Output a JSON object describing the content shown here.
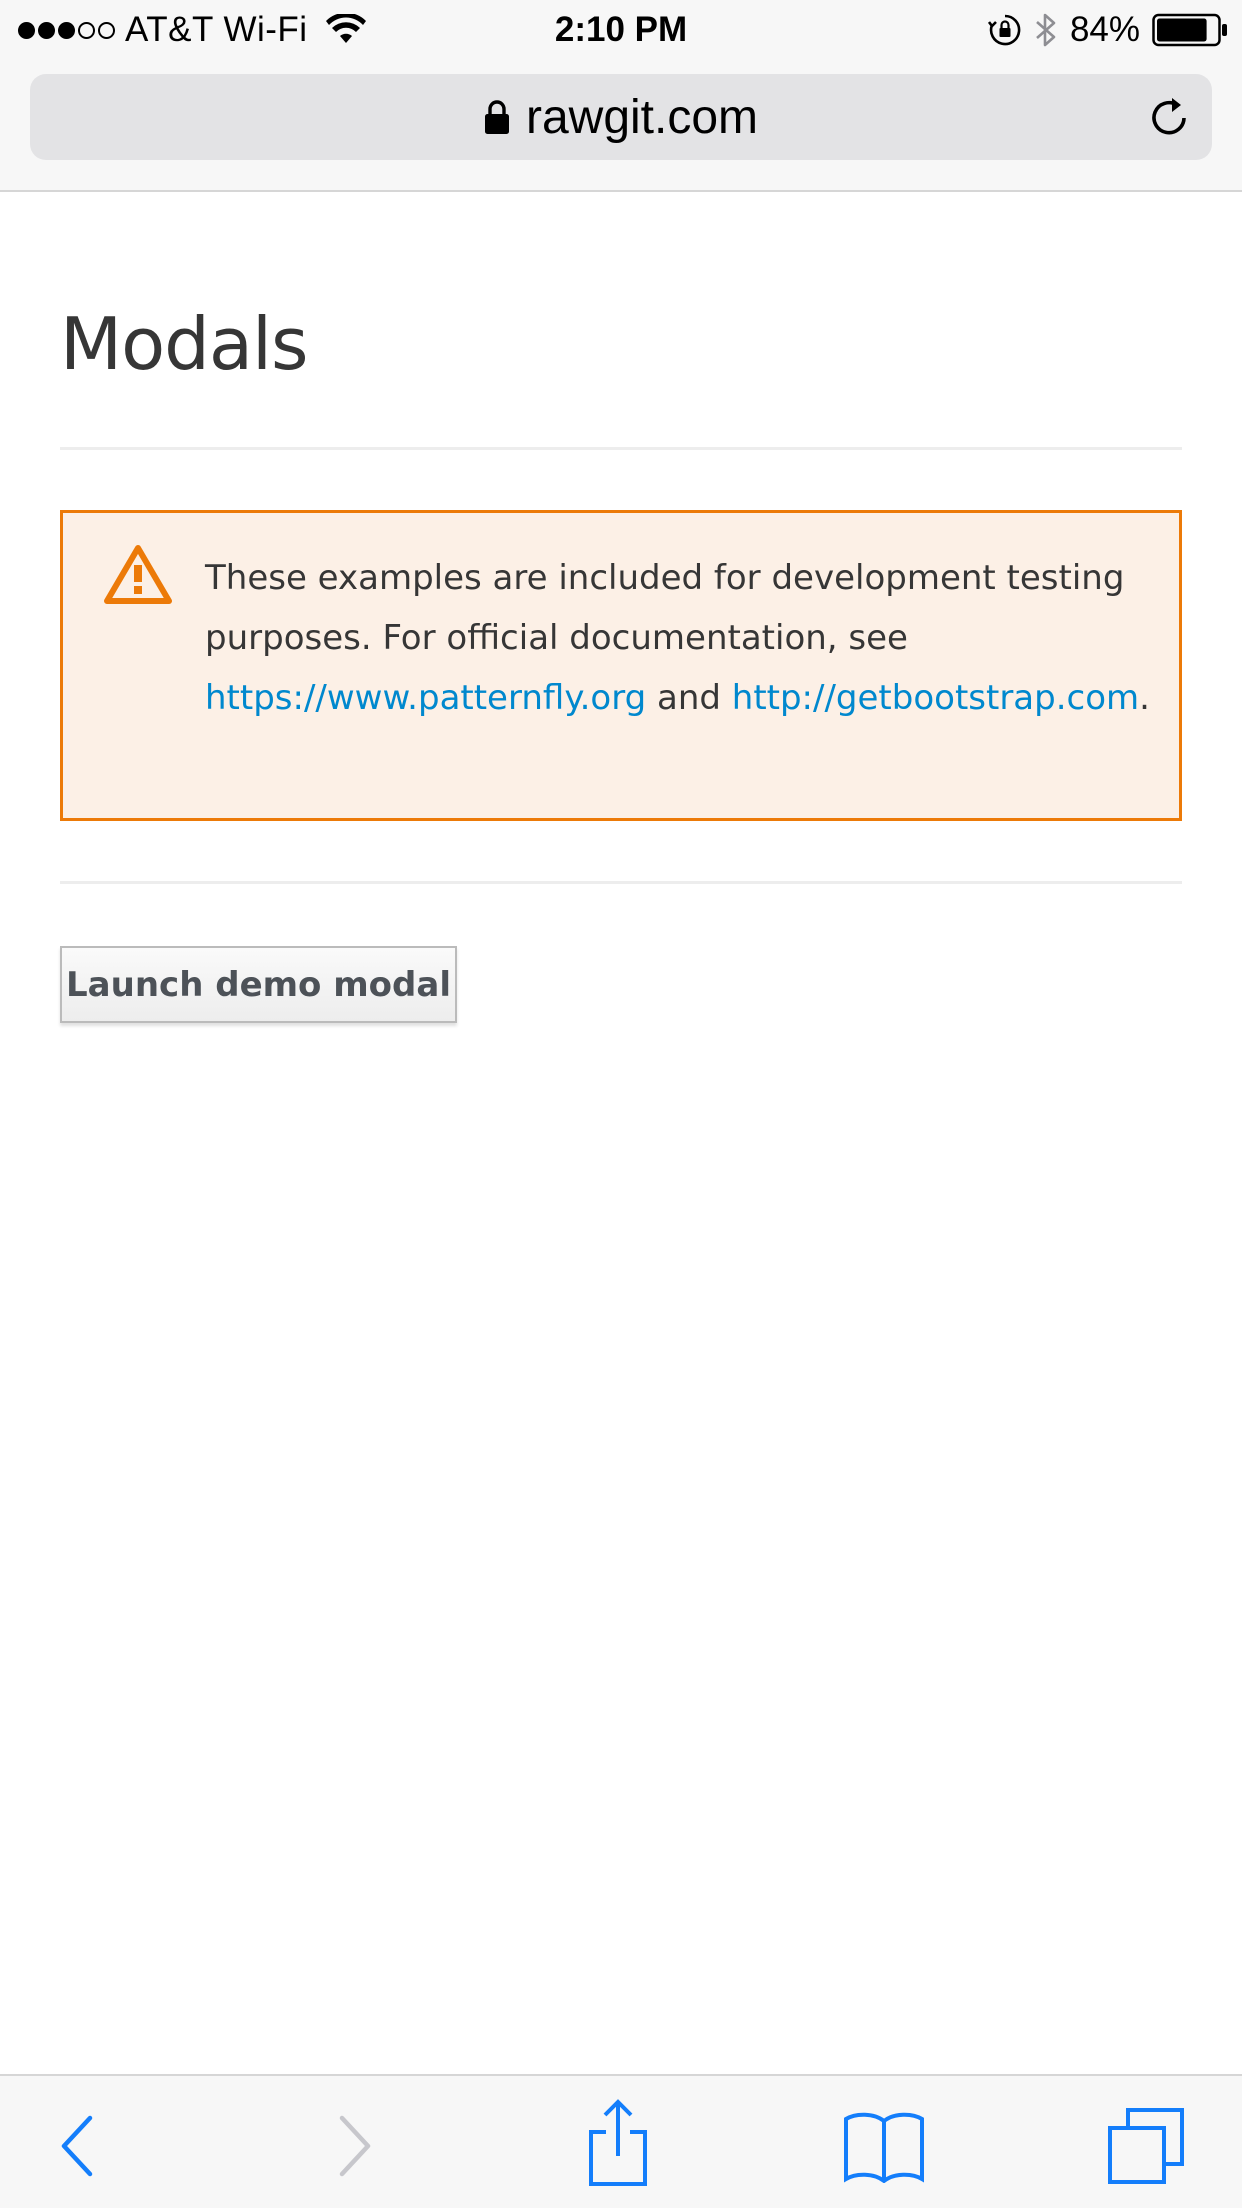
{
  "status_bar": {
    "carrier": "AT&T Wi-Fi",
    "signal_bars_filled": 3,
    "signal_bars_total": 5,
    "time": "2:10 PM",
    "battery_percent": "84%",
    "battery_level": 0.84
  },
  "browser": {
    "url": "rawgit.com"
  },
  "page": {
    "title": "Modals",
    "alert": {
      "text_before": "These examples are included for development testing purposes. For official documentation, see ",
      "link1": "https://www.patternfly.org",
      "text_between": " and ",
      "link2": "http://getbootstrap.com",
      "text_after": "."
    },
    "launch_button_label": "Launch demo modal"
  },
  "colors": {
    "warning_border": "#ec7a08",
    "warning_bg": "#fcf0e6",
    "link": "#0088ce",
    "ios_blue": "#147efb"
  },
  "icons": {
    "status": [
      "wifi-icon",
      "rotation-lock-icon",
      "bluetooth-icon",
      "battery-icon"
    ],
    "url_bar": [
      "padlock-icon",
      "reload-icon"
    ],
    "alert": "warning-triangle-icon",
    "toolbar": [
      "back-icon",
      "forward-icon",
      "share-icon",
      "bookmarks-icon",
      "tabs-icon"
    ]
  }
}
